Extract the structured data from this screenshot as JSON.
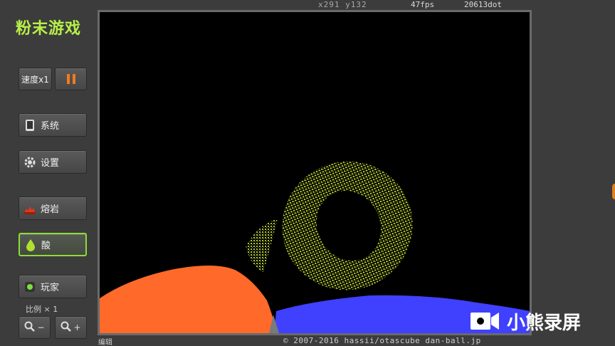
{
  "app": {
    "title": "粉末游戏"
  },
  "status_bar": {
    "coords": "x291 y132",
    "fps": "47fps",
    "dots": "20613dot"
  },
  "controls": {
    "speed_label": "速度x1",
    "system_label": "系统",
    "settings_label": "设置",
    "lava_label": "熔岩",
    "acid_label": "酸",
    "player_label": "玩家",
    "scale_label": "比例 × 1",
    "zoom_out_label": "−",
    "zoom_in_label": "+"
  },
  "footer": {
    "edit_label": "编辑",
    "copyright": "© 2007-2016 hassii/otascube dan-ball.jp"
  },
  "watermark": {
    "text": "小熊录屏"
  },
  "colors": {
    "accent_green": "#b8f048",
    "pause_orange": "#f07c20",
    "lava": "#ff6a2a",
    "water": "#4040ff",
    "acid_particles": "#c8e030",
    "canvas_bg": "#000000"
  },
  "icons": [
    "pause-icon",
    "tablet-icon",
    "gear-icon",
    "lava-icon",
    "droplet-icon",
    "player-icon",
    "zoom-out-icon",
    "zoom-in-icon",
    "camera-icon"
  ]
}
